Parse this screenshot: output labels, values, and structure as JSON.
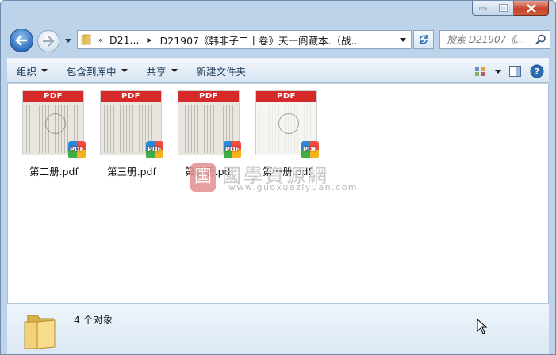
{
  "window": {
    "caption": {
      "minimize_icon": "minimize-icon",
      "maximize_icon": "maximize-icon",
      "close_icon": "close-icon"
    }
  },
  "nav": {
    "address": {
      "overflow_chevron": "«",
      "crumbs": [
        "D21...",
        "D21907《韩非子二十卷》天一阁藏本.（战..."
      ]
    },
    "search": {
      "placeholder": "搜索 D21907《..."
    }
  },
  "toolbar": {
    "organize": "组织",
    "include_in_library": "包含到库中",
    "share": "共享",
    "new_folder": "新建文件夹"
  },
  "files": [
    {
      "name": "第二册.pdf",
      "thumb_label": "PDF",
      "badge": "PDF"
    },
    {
      "name": "第三册.pdf",
      "thumb_label": "PDF",
      "badge": "PDF"
    },
    {
      "name": "第四册.pdf",
      "thumb_label": "PDF",
      "badge": "PDF"
    },
    {
      "name": "第一册.pdf",
      "thumb_label": "PDF",
      "badge": "PDF"
    }
  ],
  "watermark": {
    "logo_char": "国",
    "title": "國學資源網",
    "url": "www.guoxueziyuan.com"
  },
  "details": {
    "count_text": "4 个对象"
  },
  "colors": {
    "pdf_red": "#d62a2a",
    "toolbar_text": "#1e395b",
    "frame": "#bcd3ea"
  }
}
